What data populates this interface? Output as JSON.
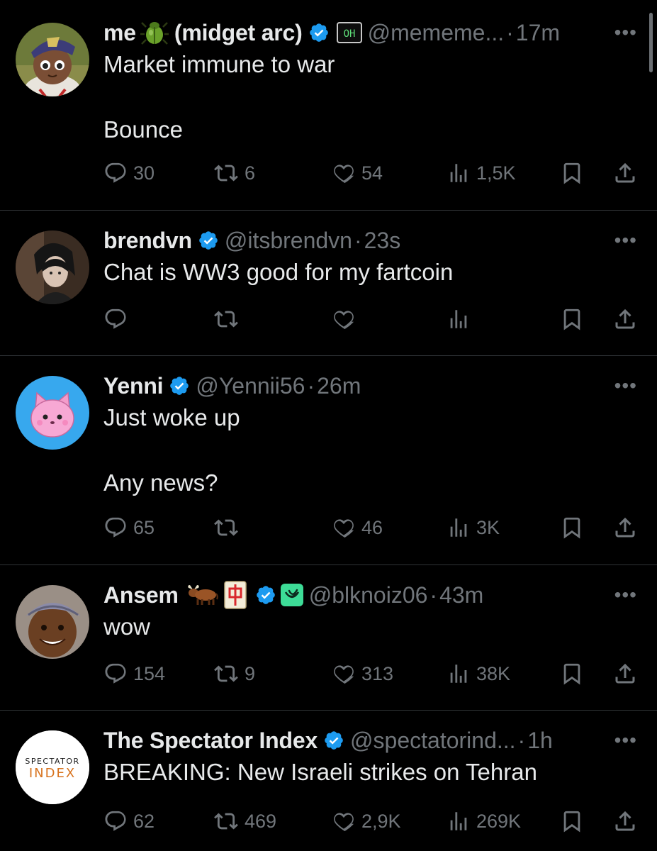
{
  "tweets": [
    {
      "name": "me",
      "name_suffix": "(midget arc)",
      "handle": "@mememe...",
      "time": "17m",
      "text": "Market immune to war\n\nBounce",
      "reply": "30",
      "retweet": "6",
      "like": "54",
      "views": "1,5K",
      "badges": [
        "beetle-emoji",
        "verified-icon",
        "affiliate-badge"
      ]
    },
    {
      "name": "brendvn",
      "handle": "@itsbrendvn",
      "time": "23s",
      "text": "Chat is WW3 good for my fartcoin",
      "reply": "",
      "retweet": "",
      "like": "",
      "views": ""
    },
    {
      "name": "Yenni",
      "handle": "@Yennii56",
      "time": "26m",
      "text": "Just woke up\n\nAny news?",
      "reply": "65",
      "retweet": "",
      "like": "46",
      "views": "3K"
    },
    {
      "name": "Ansem",
      "handle": "@blknoiz06",
      "time": "43m",
      "text": "wow",
      "reply": "154",
      "retweet": "9",
      "like": "313",
      "views": "38K",
      "badges": [
        "ox-emoji",
        "mahjong-emoji",
        "verified-icon",
        "affiliate-badge"
      ]
    },
    {
      "name": "The Spectator Index",
      "handle": "@spectatorind...",
      "time": "1h",
      "text": "BREAKING: New Israeli strikes on Tehran",
      "reply": "62",
      "retweet": "469",
      "like": "2,9K",
      "views": "269K",
      "avatar_text_top": "SPECTATOR",
      "avatar_text_bottom": "INDEX"
    }
  ],
  "separator": "·",
  "more_glyph": "•••",
  "colors": {
    "background": "#000000",
    "text": "#e7e9ea",
    "muted": "#71767b",
    "verified": "#1d9bf0",
    "divider": "#2f3336"
  }
}
